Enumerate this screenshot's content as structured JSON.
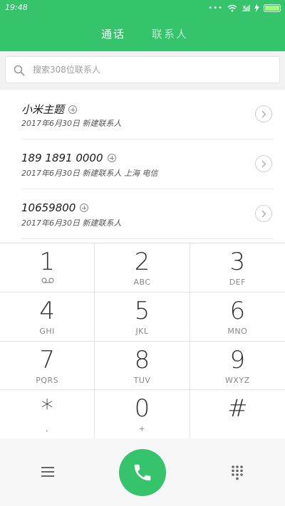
{
  "status_bar": {
    "time": "19:48",
    "signal_dots": "•••"
  },
  "tabs": {
    "calls": "通话",
    "contacts": "联系人"
  },
  "search": {
    "placeholder": "搜索308位联系人"
  },
  "call_log": [
    {
      "title": "小米主题",
      "subtitle": "2017年6月30日  新建联系人"
    },
    {
      "title": "189 1891 0000",
      "subtitle": "2017年6月30日  新建联系人  上海  电信"
    },
    {
      "title": "10659800",
      "subtitle": "2017年6月30日  新建联系人"
    }
  ],
  "keypad": {
    "keys": [
      {
        "num": "1",
        "sub": ""
      },
      {
        "num": "2",
        "sub": "ABC"
      },
      {
        "num": "3",
        "sub": "DEF"
      },
      {
        "num": "4",
        "sub": "GHI"
      },
      {
        "num": "5",
        "sub": "JKL"
      },
      {
        "num": "6",
        "sub": "MNO"
      },
      {
        "num": "7",
        "sub": "PQRS"
      },
      {
        "num": "8",
        "sub": "TUV"
      },
      {
        "num": "9",
        "sub": "WXYZ"
      },
      {
        "num": "*",
        "sub": ","
      },
      {
        "num": "0",
        "sub": "+"
      },
      {
        "num": "#",
        "sub": ""
      }
    ]
  },
  "colors": {
    "accent": "#35c36b"
  },
  "icons": {
    "search": "search-icon",
    "add_contact": "plus-circle-icon",
    "detail": "chevron-right-icon",
    "voicemail": "voicemail-icon",
    "menu": "menu-icon",
    "call": "phone-icon",
    "dialpad": "dialpad-icon"
  }
}
